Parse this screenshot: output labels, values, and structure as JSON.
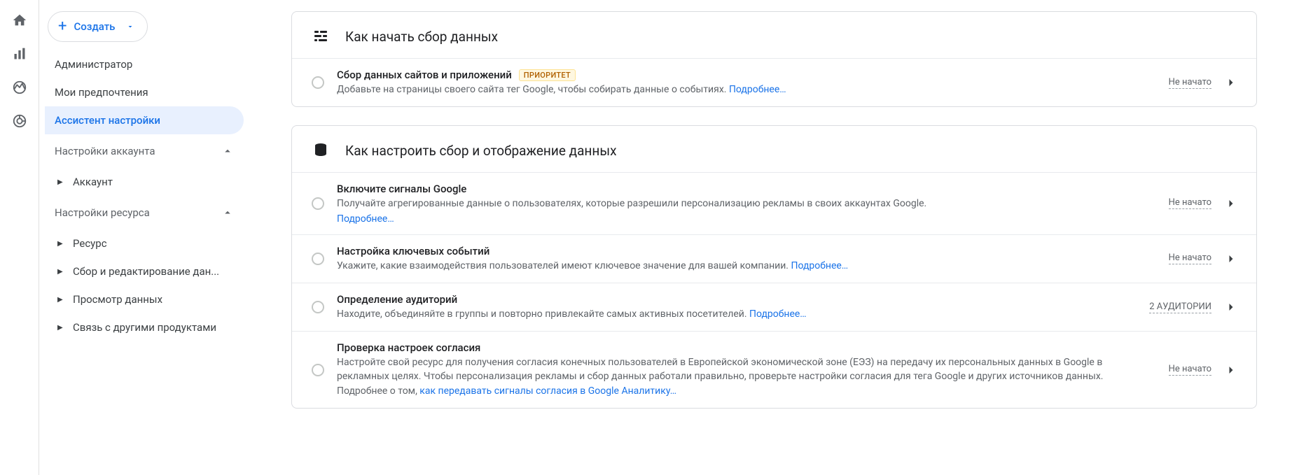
{
  "create_label": "Создать",
  "nav": {
    "admin": "Администратор",
    "prefs": "Мои предпочтения",
    "assistant": "Ассистент настройки",
    "account_settings": "Настройки аккаунта",
    "account": "Аккаунт",
    "property_settings": "Настройки ресурса",
    "property": "Ресурс",
    "data_collection": "Сбор и редактирование дан...",
    "data_display": "Просмотр данных",
    "product_links": "Связь с другими продуктами"
  },
  "section1": {
    "title": "Как начать сбор данных",
    "item1": {
      "title": "Сбор данных сайтов и приложений",
      "badge": "ПРИОРИТЕТ",
      "desc": "Добавьте на страницы своего сайта тег Google, чтобы собирать данные о событиях. ",
      "learn": "Подробнее…",
      "status": "Не начато"
    }
  },
  "section2": {
    "title": "Как настроить сбор и отображение данных",
    "item1": {
      "title": "Включите сигналы Google",
      "desc": "Получайте агрегированные данные о пользователях, которые разрешили персонализацию рекламы в своих аккаунтах Google.",
      "learn": "Подробнее…",
      "status": "Не начато"
    },
    "item2": {
      "title": "Настройка ключевых событий",
      "desc": "Укажите, какие взаимодействия пользователей имеют ключевое значение для вашей компании. ",
      "learn": "Подробнее…",
      "status": "Не начато"
    },
    "item3": {
      "title": "Определение аудиторий",
      "desc": "Находите, объединяйте в группы и повторно привлекайте самых активных посетителей. ",
      "learn": "Подробнее…",
      "status": "2 АУДИТОРИИ"
    },
    "item4": {
      "title": "Проверка настроек согласия",
      "desc": "Настройте свой ресурс для получения согласия конечных пользователей в Европейской экономической зоне (ЕЭЗ) на передачу их персональных данных в Google в рекламных целях. Чтобы персонализация рекламы и сбор данных работали правильно, проверьте настройки согласия для тега Google и других источников данных. Подробнее о том, ",
      "learn": "как передавать сигналы согласия в Google Аналитику…",
      "status": "Не начато"
    }
  }
}
